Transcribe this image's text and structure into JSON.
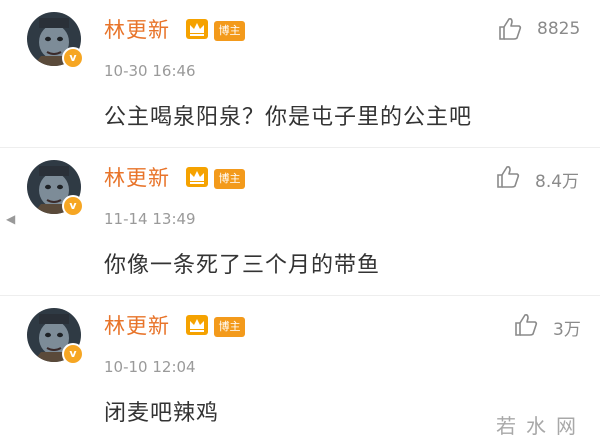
{
  "comments": [
    {
      "username": "林更新",
      "badge": "博主",
      "timestamp": "10-30 16:46",
      "text": "公主喝泉阳泉？你是屯子里的公主吧",
      "likes": "8825"
    },
    {
      "username": "林更新",
      "badge": "博主",
      "timestamp": "11-14 13:49",
      "text": "你像一条死了三个月的带鱼",
      "likes": "8.4万"
    },
    {
      "username": "林更新",
      "badge": "博主",
      "timestamp": "10-10 12:04",
      "text": "闭麦吧辣鸡",
      "likes": "3万"
    }
  ],
  "verified_mark": "v",
  "watermark": "若水网",
  "colors": {
    "username": "#e8742a",
    "badge": "#f39a1b",
    "verified": "#f6a623",
    "crown": "#f5a200",
    "text": "#333333",
    "meta": "#9a9a9a"
  },
  "icons": [
    "crown-icon",
    "thumbs-up-icon",
    "verified-badge-icon",
    "left-arrow-icon"
  ]
}
